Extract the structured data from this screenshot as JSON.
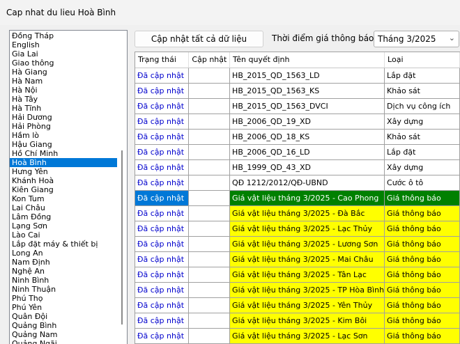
{
  "window": {
    "title": "Cap nhat du lieu Hoà Bình"
  },
  "provinces": [
    "Đồng Tháp",
    "English",
    "Gia Lai",
    "Giao thông",
    "Hà Giang",
    "Hà Nam",
    "Hà Nội",
    "Hà Tây",
    "Hà Tĩnh",
    "Hải Dương",
    "Hải Phòng",
    "Hầm lò",
    "Hậu Giang",
    "Hồ Chí Minh",
    "Hoà Bình",
    "Hưng Yên",
    "Khánh Hoà",
    "Kiên Giang",
    "Kon Tum",
    "Lai Châu",
    "Lâm Đồng",
    "Lạng Sơn",
    "Lào Cai",
    "Lắp đặt máy & thiết bị",
    "Long An",
    "Nam Định",
    "Nghệ An",
    "Ninh Bình",
    "Ninh Thuận",
    "Phú Thọ",
    "Phú Yên",
    "Quân Đội",
    "Quảng Bình",
    "Quảng Nam",
    "Quảng Ngãi"
  ],
  "selected_province": "Hoà Bình",
  "toolbar": {
    "update_all_label": "Cập nhật tất cả dữ liệu",
    "time_label": "Thời điểm giá thông báo",
    "month_value": "Tháng 3/2025"
  },
  "table": {
    "columns": [
      "Trạng thái",
      "Cập nhật",
      "Tên quyết định",
      "Loại"
    ],
    "rows": [
      {
        "status": "Đã cập nhật",
        "update": "",
        "name": "HB_2015_QD_1563_LD",
        "type": "Lắp đặt",
        "highlight": "none"
      },
      {
        "status": "Đã cập nhật",
        "update": "",
        "name": "HB_2015_QD_1563_KS",
        "type": "Khảo sát",
        "highlight": "none"
      },
      {
        "status": "Đã cập nhật",
        "update": "",
        "name": "HB_2015_QD_1563_DVCI",
        "type": "Dịch vụ công ích",
        "highlight": "none"
      },
      {
        "status": "Đã cập nhật",
        "update": "",
        "name": "HB_2006_QD_19_XD",
        "type": "Xây dựng",
        "highlight": "none"
      },
      {
        "status": "Đã cập nhật",
        "update": "",
        "name": "HB_2006_QD_18_KS",
        "type": "Khảo sát",
        "highlight": "none"
      },
      {
        "status": "Đã cập nhật",
        "update": "",
        "name": "HB_2006_QD_16_LD",
        "type": "Lắp đặt",
        "highlight": "none"
      },
      {
        "status": "Đã cập nhật",
        "update": "",
        "name": "HB_1999_QD_43_XD",
        "type": "Xây dựng",
        "highlight": "none"
      },
      {
        "status": "Đã cập nhật",
        "update": "",
        "name": "QĐ 1212/2012/QĐ-UBND",
        "type": "Cước ô tô",
        "highlight": "none"
      },
      {
        "status": "Đã cập nhật",
        "update": "",
        "name": "Giá vật liệu tháng 3/2025 - Cao Phong",
        "type": "Giá thông báo",
        "highlight": "green"
      },
      {
        "status": "Đã cập nhật",
        "update": "",
        "name": "Giá vật liệu tháng 3/2025 - Đà Bắc",
        "type": "Giá thông báo",
        "highlight": "yellow"
      },
      {
        "status": "Đã cập nhật",
        "update": "",
        "name": "Giá vật liệu tháng 3/2025 - Lạc Thủy",
        "type": "Giá thông báo",
        "highlight": "yellow"
      },
      {
        "status": "Đã cập nhật",
        "update": "",
        "name": "Giá vật liệu tháng 3/2025 - Lương Sơn",
        "type": "Giá thông báo",
        "highlight": "yellow"
      },
      {
        "status": "Đã cập nhật",
        "update": "",
        "name": "Giá vật liệu tháng 3/2025 - Mai Châu",
        "type": "Giá thông báo",
        "highlight": "yellow"
      },
      {
        "status": "Đã cập nhật",
        "update": "",
        "name": "Giá vật liệu tháng 3/2025 - Tân Lạc",
        "type": "Giá thông báo",
        "highlight": "yellow"
      },
      {
        "status": "Đã cập nhật",
        "update": "",
        "name": "Giá vật liệu tháng 3/2025 - TP Hòa Bình",
        "type": "Giá thông báo",
        "highlight": "yellow"
      },
      {
        "status": "Đã cập nhật",
        "update": "",
        "name": "Giá vật liệu tháng 3/2025 - Yên Thủy",
        "type": "Giá thông báo",
        "highlight": "yellow"
      },
      {
        "status": "Đã cập nhật",
        "update": "",
        "name": "Giá vật liệu tháng 3/2025 - Kim Bôi",
        "type": "Giá thông báo",
        "highlight": "yellow"
      },
      {
        "status": "Đã cập nhật",
        "update": "",
        "name": "Giá vật liệu tháng 3/2025 - Lạc Sơn",
        "type": "Giá thông báo",
        "highlight": "yellow"
      }
    ]
  },
  "colors": {
    "selection": "#0078d7",
    "status_text": "#0000cd",
    "highlight_yellow": "#ffff00",
    "highlight_green": "#008000"
  }
}
